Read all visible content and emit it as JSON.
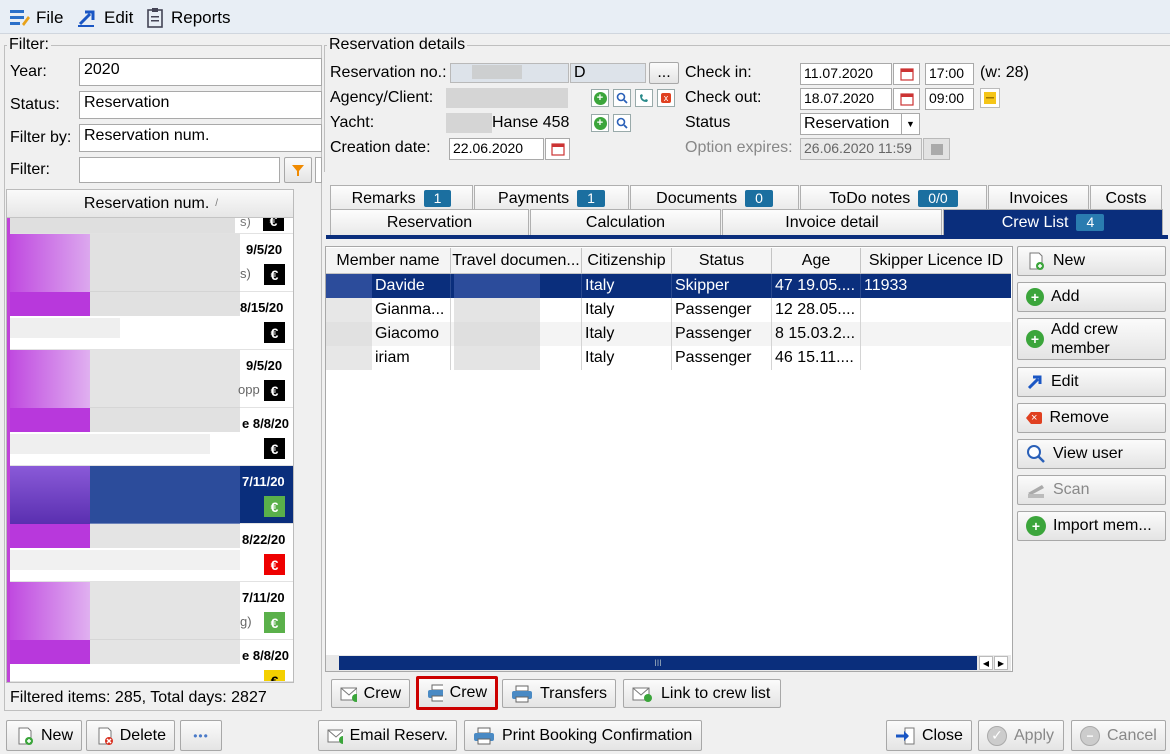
{
  "menu": {
    "file": "File",
    "edit": "Edit",
    "reports": "Reports"
  },
  "filter": {
    "group_title": "Filter:",
    "year_label": "Year:",
    "year_value": "2020",
    "status_label": "Status:",
    "status_value": "Reservation",
    "filter_by_label": "Filter by:",
    "filter_by_value": "Reservation num.",
    "filter_label": "Filter:",
    "filter_value": "",
    "list_header": "Reservation num.",
    "rows": [
      {
        "tail": "s)",
        "date": "",
        "euro": "black"
      },
      {
        "tail": "",
        "date": "9/5/20",
        "sub": "s)",
        "euro": "black"
      },
      {
        "tail": "",
        "date": "8/15/20",
        "sub": "",
        "euro": "black"
      },
      {
        "tail": "",
        "date": "9/5/20",
        "sub": "opp",
        "euro": "black"
      },
      {
        "tail": "",
        "date": "8/8/20",
        "sub": "e",
        "euro": "black"
      },
      {
        "tail": "",
        "date": "7/11/20",
        "sub": "",
        "euro": "green"
      },
      {
        "tail": "",
        "date": "8/22/20",
        "sub": "",
        "euro": "red"
      },
      {
        "tail": "",
        "date": "7/11/20",
        "sub": "g)",
        "euro": "green"
      },
      {
        "tail": "",
        "date": "8/8/20",
        "sub": "e",
        "euro": "yellow"
      }
    ],
    "euro_symbol": "€",
    "footer": "Filtered items: 285,  Total days: 2827"
  },
  "details": {
    "group_title": "Reservation details",
    "res_no_label": "Reservation no.:",
    "res_no_value": "D",
    "dots": "...",
    "agency_label": "Agency/Client:",
    "yacht_label": "Yacht:",
    "yacht_value": "Hanse 458",
    "creation_label": "Creation date:",
    "creation_value": "22.06.2020",
    "checkin_label": "Check in:",
    "checkin_date": "11.07.2020",
    "checkin_time": "17:00",
    "week": "(w: 28)",
    "checkout_label": "Check out:",
    "checkout_date": "18.07.2020",
    "checkout_time": "09:00",
    "status_label": "Status",
    "status_value": "Reservation",
    "option_label": "Option expires:",
    "option_value": "26.06.2020 11:59"
  },
  "tabs_top": [
    {
      "label": "Remarks",
      "badge": "1"
    },
    {
      "label": "Payments",
      "badge": "1"
    },
    {
      "label": "Documents",
      "badge": "0"
    },
    {
      "label": "ToDo notes",
      "badge": "0/0"
    },
    {
      "label": "Invoices",
      "badge": ""
    },
    {
      "label": "Costs",
      "badge": ""
    }
  ],
  "tabs_bottom": [
    {
      "label": "Reservation",
      "badge": ""
    },
    {
      "label": "Calculation",
      "badge": ""
    },
    {
      "label": "Invoice detail",
      "badge": ""
    },
    {
      "label": "Crew List",
      "badge": "4"
    }
  ],
  "crew_table": {
    "columns": [
      "Member name",
      "Travel documen...",
      "Citizenship",
      "Status",
      "Age",
      "Skipper Licence ID"
    ],
    "rows": [
      [
        "Davide",
        "",
        "Italy",
        "Skipper",
        "47 19.05....",
        "11933"
      ],
      [
        "Gianma...",
        "",
        "Italy",
        "Passenger",
        "12 28.05....",
        ""
      ],
      [
        "Giacomo",
        "",
        "Italy",
        "Passenger",
        "8 15.03.2...",
        ""
      ],
      [
        "iriam",
        "",
        "Italy",
        "Passenger",
        "46 15.11....",
        ""
      ]
    ],
    "scroll_grip": "III"
  },
  "side_buttons": {
    "new": "New",
    "add": "Add",
    "add_crew": "Add crew member",
    "edit": "Edit",
    "remove": "Remove",
    "view_user": "View user",
    "scan": "Scan",
    "import": "Import mem..."
  },
  "crew_actions": {
    "crew_email": "Crew",
    "crew_print": "Crew",
    "transfers": "Transfers",
    "link": "Link to crew list"
  },
  "bottom": {
    "new": "New",
    "delete": "Delete",
    "more": "•••",
    "email": "Email Reserv.",
    "print": "Print Booking Confirmation",
    "close": "Close",
    "apply": "Apply",
    "cancel": "Cancel"
  },
  "colors": {
    "selection": "#0a2e7c",
    "badge": "#1b6fa0",
    "highlight_border": "#cc0000"
  }
}
